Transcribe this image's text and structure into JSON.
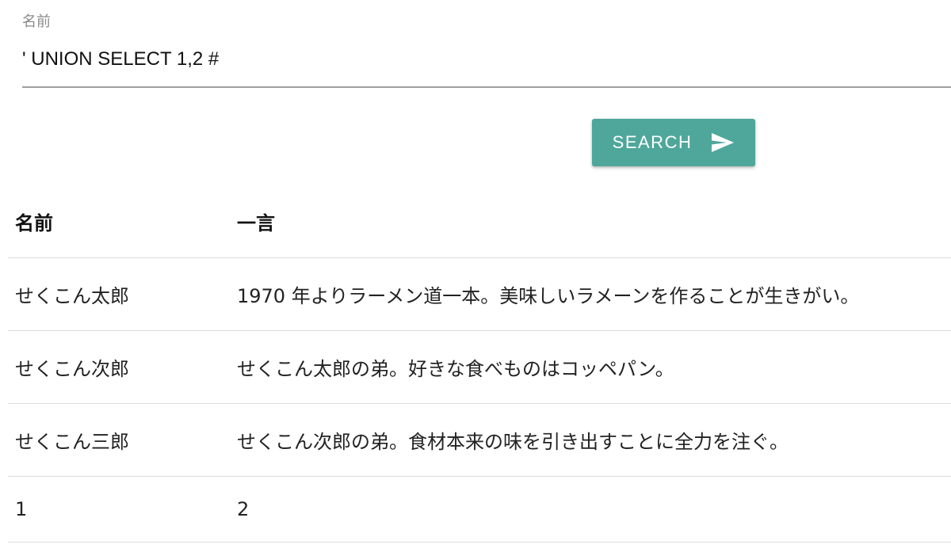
{
  "form": {
    "name_label": "名前",
    "name_value": "' UNION SELECT 1,2 #"
  },
  "search_button": {
    "label": "SEARCH",
    "icon": "send-icon",
    "color": "#4fa79b"
  },
  "table": {
    "headers": [
      "名前",
      "一言"
    ],
    "rows": [
      [
        "せくこん太郎",
        "1970 年よりラーメン道一本。美味しいラメーンを作ることが生きがい。"
      ],
      [
        "せくこん次郎",
        "せくこん太郎の弟。好きな食べものはコッペパン。"
      ],
      [
        "せくこん三郎",
        "せくこん次郎の弟。食材本来の味を引き出すことに全力を注ぐ。"
      ],
      [
        "1",
        "2"
      ]
    ]
  }
}
